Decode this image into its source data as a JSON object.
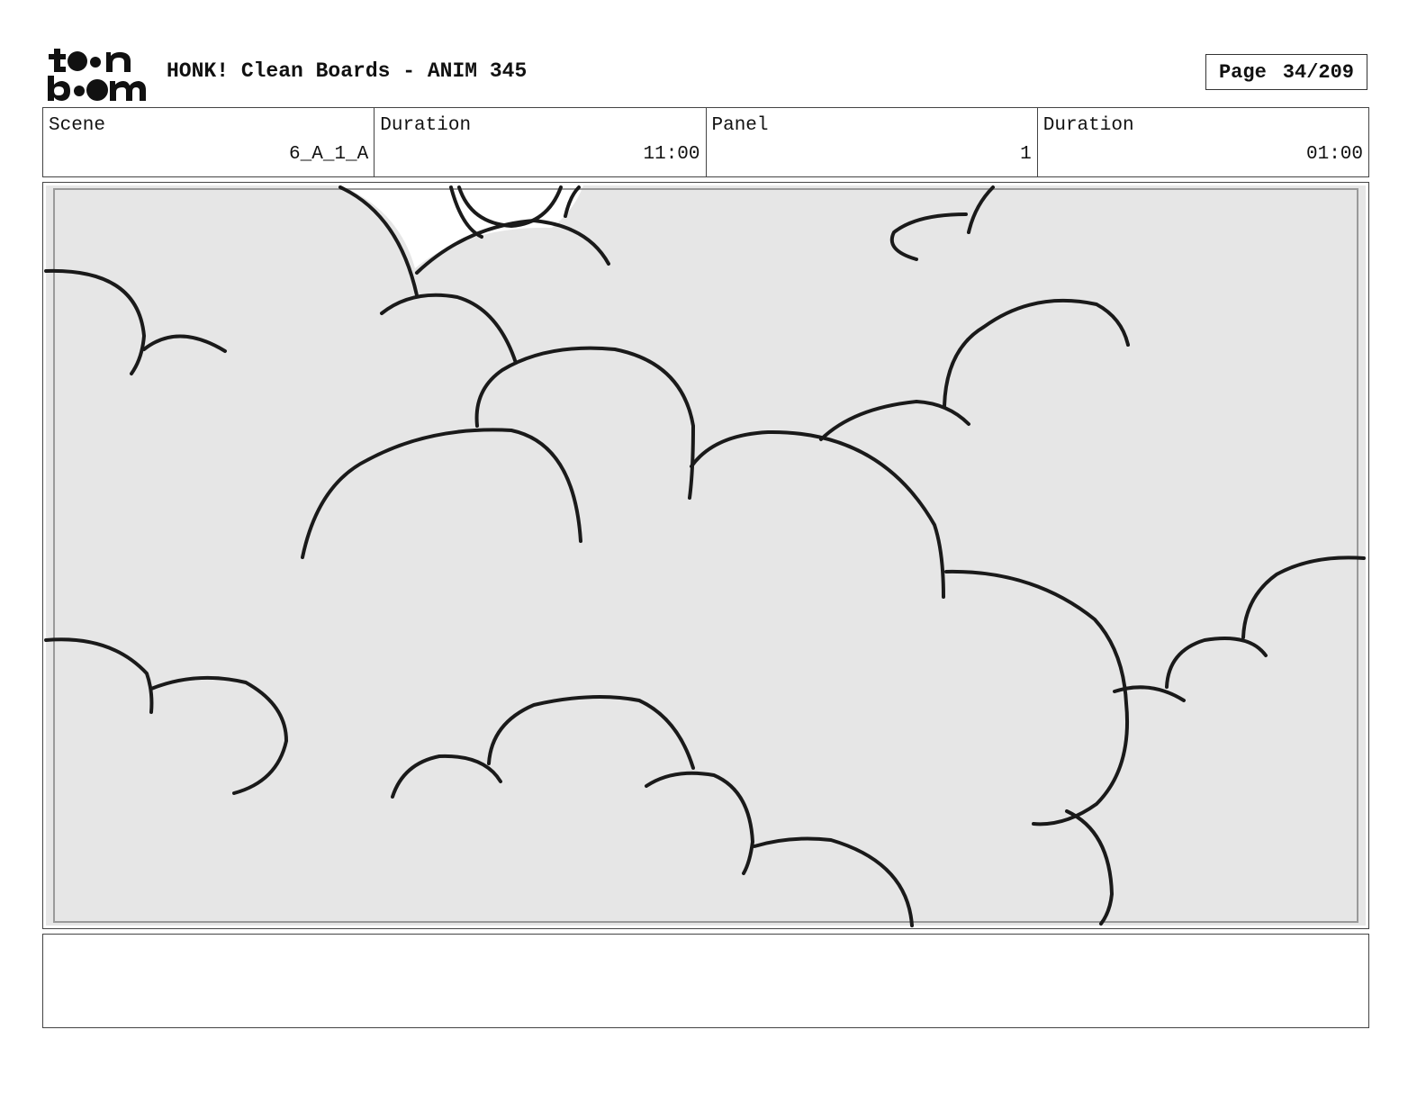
{
  "header": {
    "logo_icon": "toon-boom-logo-icon",
    "title": "HONK! Clean Boards - ANIM 345",
    "page_label": "Page",
    "page_number": "34/209"
  },
  "info": {
    "scene_label": "Scene",
    "scene_value": "6_A_1_A",
    "scene_duration_label": "Duration",
    "scene_duration_value": "11:00",
    "panel_label": "Panel",
    "panel_value": "1",
    "panel_duration_label": "Duration",
    "panel_duration_value": "01:00"
  },
  "panel": {
    "background_color": "#e6e6e6",
    "line_color": "#1a1a1a",
    "safe_frame_color": "#9a9a9a"
  },
  "notes": {
    "text": ""
  }
}
